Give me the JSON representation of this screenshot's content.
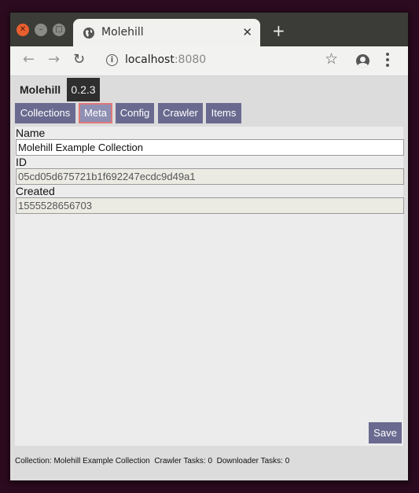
{
  "browser": {
    "tab_title": "Molehill",
    "new_tab_symbol": "+",
    "tab_close_symbol": "✕",
    "url_host": "localhost",
    "url_port": ":8080"
  },
  "app": {
    "title": "Molehill",
    "version": "0.2.3"
  },
  "nav": {
    "tabs": [
      {
        "label": "Collections"
      },
      {
        "label": "Meta"
      },
      {
        "label": "Config"
      },
      {
        "label": "Crawler"
      },
      {
        "label": "Items"
      }
    ],
    "active": "Meta"
  },
  "form": {
    "name_label": "Name",
    "name_value": "Molehill Example Collection",
    "id_label": "ID",
    "id_value": "05cd05d675721b1f692247ecdc9d49a1",
    "created_label": "Created",
    "created_value": "1555528656703",
    "save_label": "Save"
  },
  "status": {
    "collection": "Collection: Molehill Example Collection",
    "crawler_tasks": "Crawler Tasks: 0",
    "downloader_tasks": "Downloader Tasks: 0"
  },
  "colors": {
    "accent": "#6a6a90",
    "active_tab_border": "#e07878",
    "version_badge": "#2e2e2e"
  }
}
